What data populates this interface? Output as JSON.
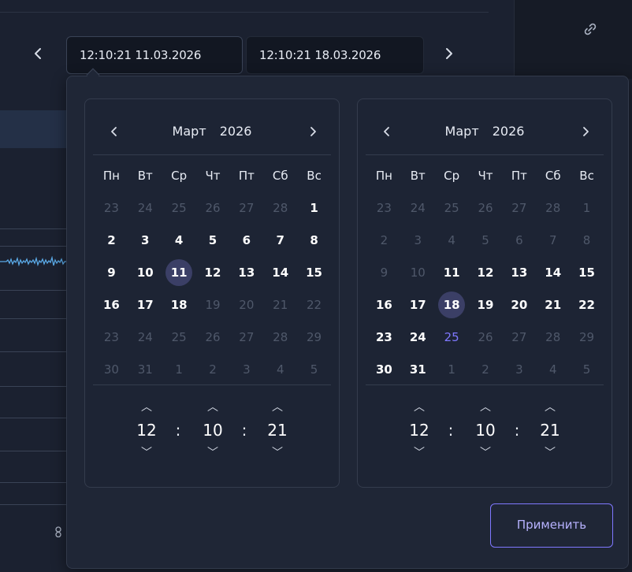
{
  "top_bar": {
    "prev_icon": "chevron-left-icon",
    "next_icon": "chevron-right-icon",
    "start_value": "12:10:21 11.03.2026",
    "end_value": "12:10:21 18.03.2026",
    "side_icon": "link-icon"
  },
  "weekdays": [
    "Пн",
    "Вт",
    "Ср",
    "Чт",
    "Пт",
    "Сб",
    "Вс"
  ],
  "calendars": [
    {
      "month": "Март",
      "year": "2026",
      "days": [
        [
          "23",
          "24",
          "25",
          "26",
          "27",
          "28",
          "1"
        ],
        [
          "2",
          "3",
          "4",
          "5",
          "6",
          "7",
          "8"
        ],
        [
          "9",
          "10",
          "11",
          "12",
          "13",
          "14",
          "15"
        ],
        [
          "16",
          "17",
          "18",
          "19",
          "20",
          "21",
          "22"
        ],
        [
          "23",
          "24",
          "25",
          "26",
          "27",
          "28",
          "29"
        ],
        [
          "30",
          "31",
          "1",
          "2",
          "3",
          "4",
          "5"
        ]
      ],
      "selected_day": "11",
      "time": {
        "hours": "12",
        "minutes": "10",
        "seconds": "21"
      }
    },
    {
      "month": "Март",
      "year": "2026",
      "days": [
        [
          "23",
          "24",
          "25",
          "26",
          "27",
          "28",
          "1"
        ],
        [
          "2",
          "3",
          "4",
          "5",
          "6",
          "7",
          "8"
        ],
        [
          "9",
          "10",
          "11",
          "12",
          "13",
          "14",
          "15"
        ],
        [
          "16",
          "17",
          "18",
          "19",
          "20",
          "21",
          "22"
        ],
        [
          "23",
          "24",
          "25",
          "26",
          "27",
          "28",
          "29"
        ],
        [
          "30",
          "31",
          "1",
          "2",
          "3",
          "4",
          "5"
        ]
      ],
      "selected_day": "18",
      "today_day": "25",
      "time": {
        "hours": "12",
        "minutes": "10",
        "seconds": "21"
      }
    }
  ],
  "apply_label": "Применить",
  "colors": {
    "accent": "#7f78ff",
    "selected_bg": "#3b3f66",
    "dim_day": "#4f586a"
  }
}
